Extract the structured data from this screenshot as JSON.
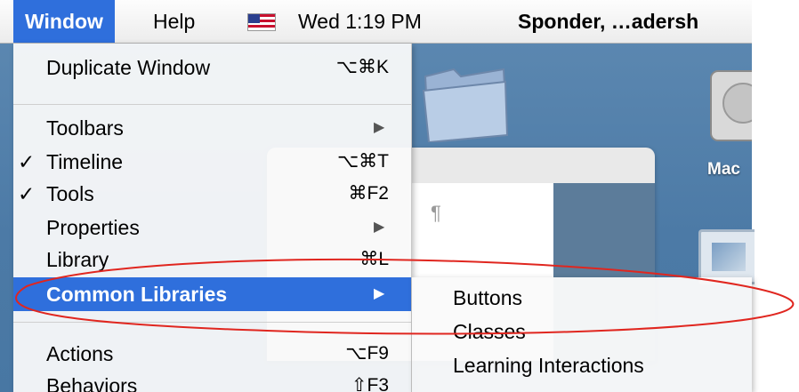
{
  "menubar": {
    "window_label": "Window",
    "help_label": "Help",
    "clock": "Wed 1:19 PM",
    "document_title": "Sponder, …adersh"
  },
  "window_menu": {
    "items": [
      {
        "label": "Duplicate Window",
        "shortcut": "⌥⌘K",
        "checked": false,
        "submenu": false
      },
      {
        "label": "Toolbars",
        "shortcut": "",
        "checked": false,
        "submenu": true
      },
      {
        "label": "Timeline",
        "shortcut": "⌥⌘T",
        "checked": true,
        "submenu": false
      },
      {
        "label": "Tools",
        "shortcut": "⌘F2",
        "checked": true,
        "submenu": false
      },
      {
        "label": "Properties",
        "shortcut": "",
        "checked": false,
        "submenu": true
      },
      {
        "label": "Library",
        "shortcut": "⌘L",
        "checked": false,
        "submenu": false
      },
      {
        "label": "Common Libraries",
        "shortcut": "",
        "checked": false,
        "submenu": true,
        "selected": true
      },
      {
        "label": "Actions",
        "shortcut": "⌥F9",
        "checked": false,
        "submenu": false
      },
      {
        "label": "Behaviors",
        "shortcut": "⇧F3",
        "checked": false,
        "submenu": false
      }
    ]
  },
  "common_libraries_submenu": {
    "items": [
      {
        "label": "Buttons"
      },
      {
        "label": "Classes"
      },
      {
        "label": "Learning Interactions"
      }
    ]
  },
  "desktop": {
    "hd_label": "Mac"
  },
  "check_mark": "✓",
  "arrow_glyph": "▶",
  "colors": {
    "selection": "#2f6fdc",
    "annotation": "#e0261f",
    "desktop": "#4c7aa6"
  }
}
